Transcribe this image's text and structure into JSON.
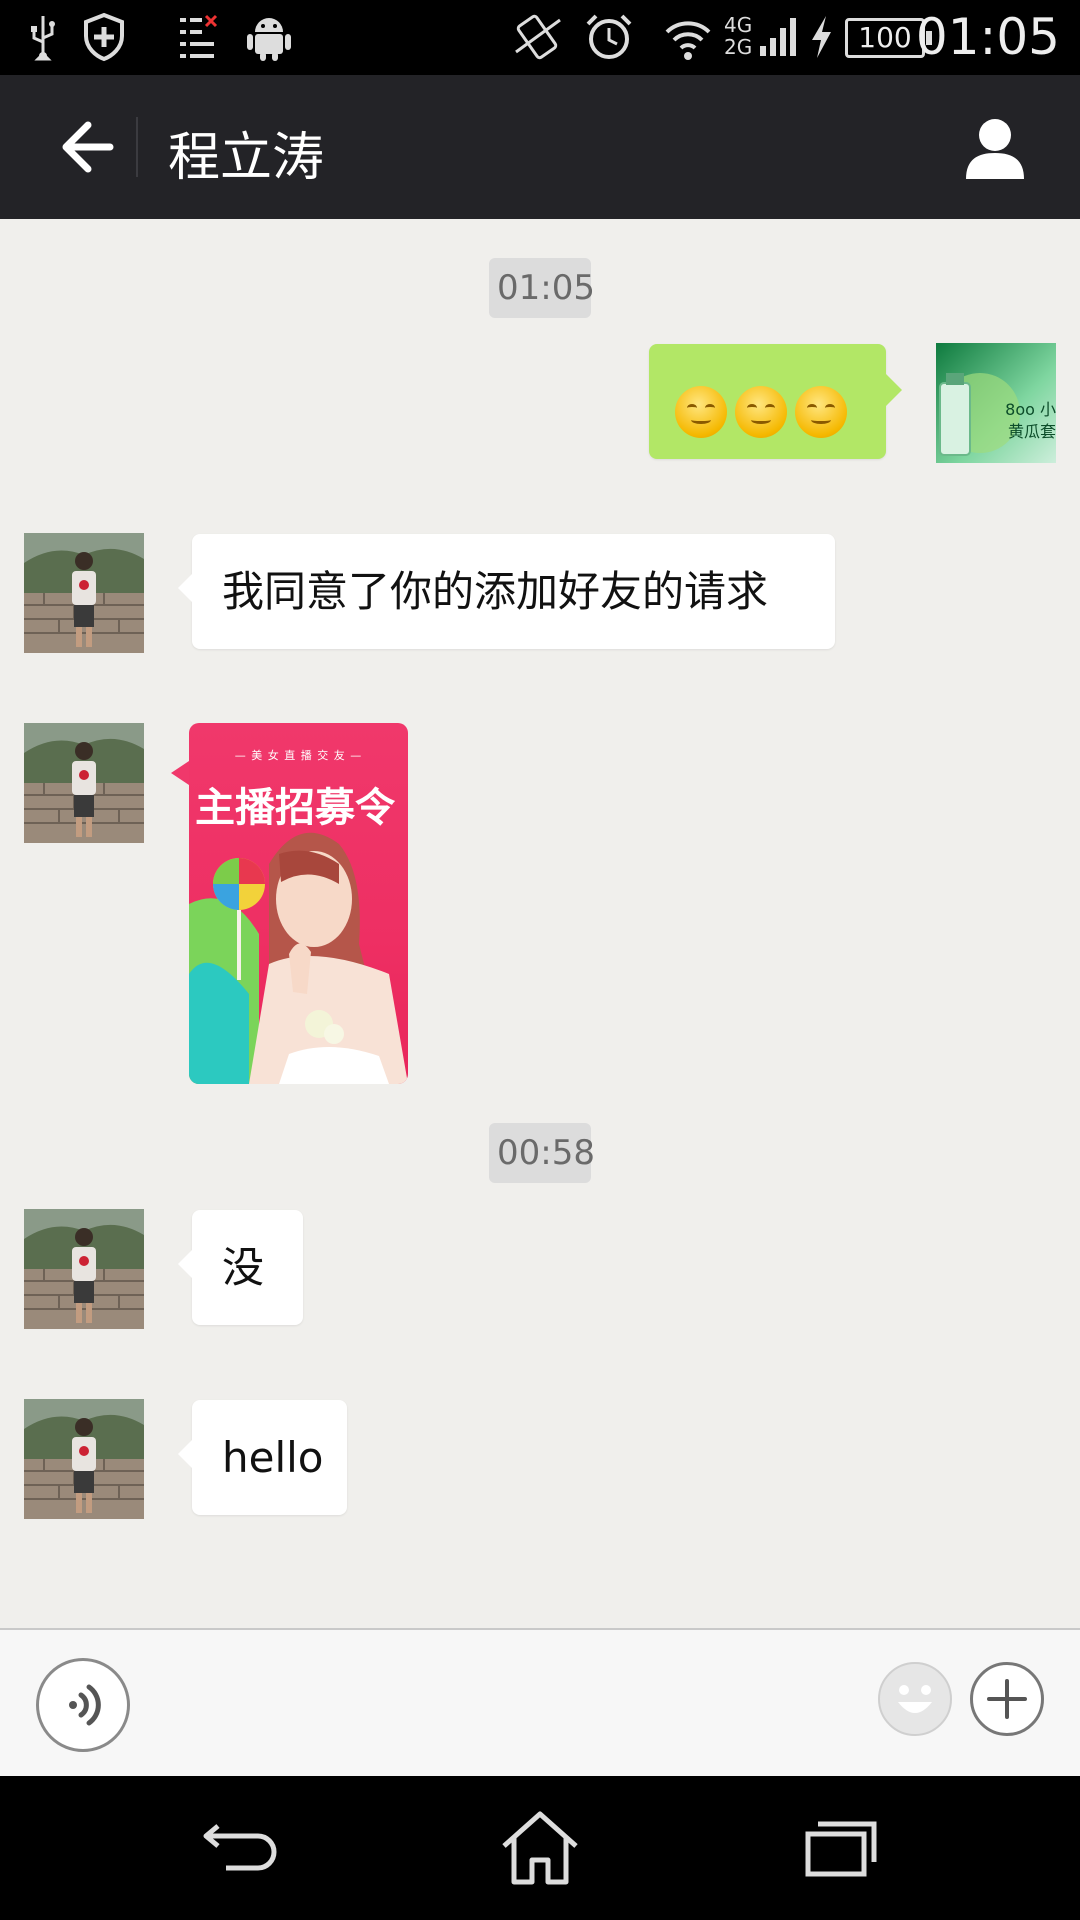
{
  "status_bar": {
    "time": "01:05",
    "battery": "100",
    "network_top": "4G",
    "network_bottom": "2G",
    "icons": [
      "usb-icon",
      "shield-plus-icon",
      "task-list-icon",
      "android-icon",
      "vibrate-icon",
      "alarm-icon",
      "wifi-icon",
      "signal-icon",
      "charging-icon",
      "battery-icon"
    ]
  },
  "header": {
    "title": "程立涛",
    "back_icon": "back-arrow-icon",
    "profile_icon": "person-icon"
  },
  "messages": [
    {
      "type": "timestamp",
      "text": "01:05"
    },
    {
      "type": "emoji",
      "side": "right",
      "emoji_count": 3,
      "emoji_name": "smile-emoji"
    },
    {
      "type": "text",
      "side": "left",
      "text": "我同意了你的添加好友的请求"
    },
    {
      "type": "image",
      "side": "left",
      "image_text_top": "— 美 女 直 播 交 友 —",
      "image_text_main": "主播招募令"
    },
    {
      "type": "timestamp",
      "text": "00:58"
    },
    {
      "type": "text",
      "side": "left",
      "text": "没"
    },
    {
      "type": "text",
      "side": "left",
      "text": "hello"
    }
  ],
  "sender_avatar_text": "8oo 小黄瓜套",
  "input_bar": {
    "voice_icon": "voice-icon",
    "emoji_icon": "emoji-icon",
    "plus_icon": "plus-icon"
  },
  "nav_bar": {
    "icons": [
      "nav-back-icon",
      "nav-home-icon",
      "nav-recents-icon"
    ]
  },
  "colors": {
    "header_bg": "#232327",
    "chat_bg": "#f0efec",
    "sent_bubble": "#b2e766",
    "received_bubble": "#ffffff",
    "timestamp_bg": "#dcdcdc"
  }
}
